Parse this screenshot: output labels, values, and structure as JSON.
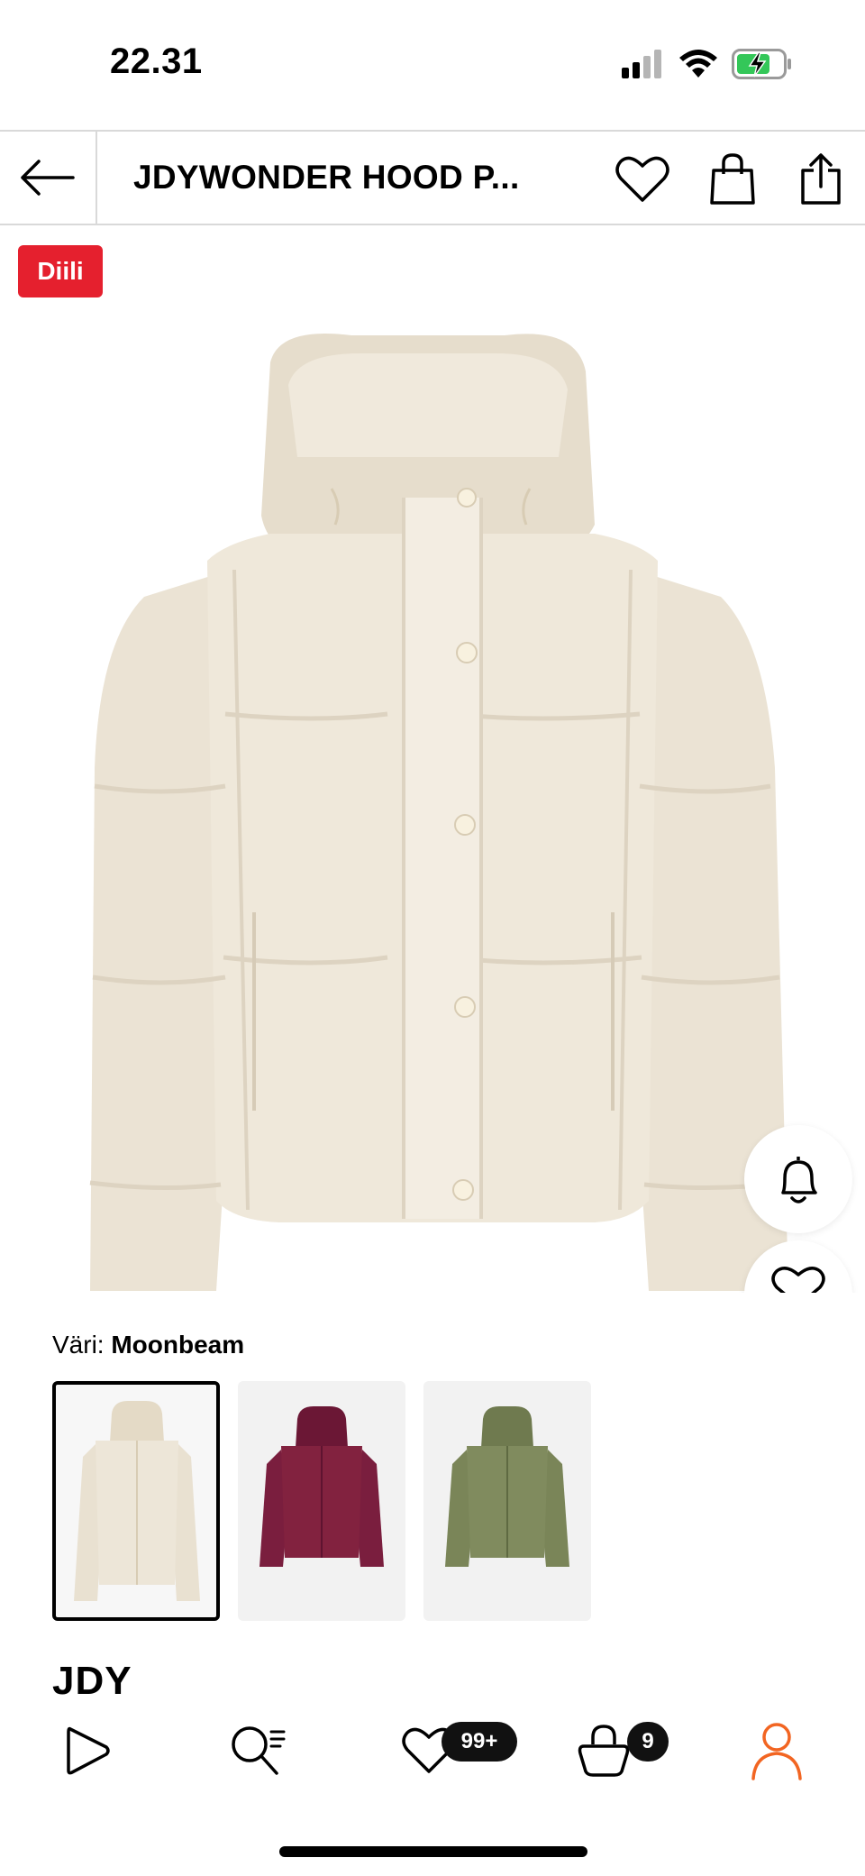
{
  "status_bar": {
    "time": "22.31",
    "signal_icon": "signal-bars-icon",
    "wifi_icon": "wifi-icon",
    "battery_icon": "battery-charging-icon"
  },
  "header": {
    "title": "JDYWONDER HOOD P...",
    "back_icon": "arrow-left-icon",
    "wishlist_icon": "heart-icon",
    "bag_icon": "shopping-bag-icon",
    "share_icon": "share-icon"
  },
  "product": {
    "deal_badge": "Diili",
    "image_alt": "jacket",
    "notify_icon": "bell-icon",
    "favorite_icon": "heart-icon",
    "ai_icon": "sparkle-crop-icon"
  },
  "color": {
    "label": "Väri:",
    "selected": "Moonbeam",
    "options": [
      {
        "name": "moonbeam",
        "hex": "#e9e1d1"
      },
      {
        "name": "burgundy",
        "hex": "#7a1e3e"
      },
      {
        "name": "olive",
        "hex": "#7a8558"
      }
    ]
  },
  "brand": "JDY",
  "bottom_nav": {
    "items": [
      {
        "icon": "play-icon"
      },
      {
        "icon": "search-icon"
      },
      {
        "icon": "heart-icon",
        "badge": "99+"
      },
      {
        "icon": "bag-icon",
        "badge": "9"
      },
      {
        "icon": "profile-icon"
      }
    ],
    "active_color": "#f26522"
  }
}
